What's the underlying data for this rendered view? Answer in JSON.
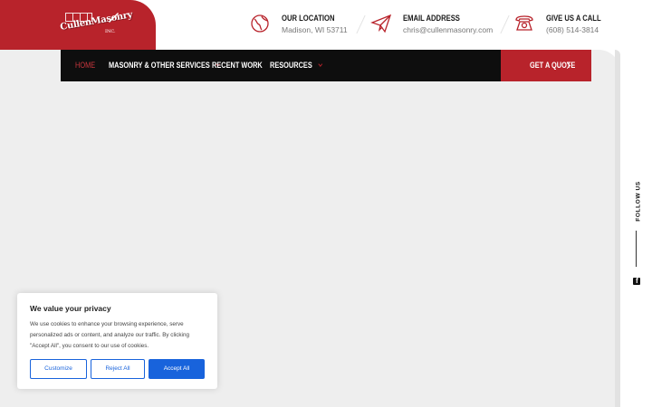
{
  "logo": {
    "name": "CullenMasonry",
    "suffix": "INC."
  },
  "contacts": [
    {
      "title": "OUR LOCATION",
      "value": "Madison, WI 53711",
      "icon": "globe-icon"
    },
    {
      "title": "EMAIL ADDRESS",
      "value": "chris@cullenmasonry.com",
      "icon": "paper-plane-icon"
    },
    {
      "title": "GIVE US A CALL",
      "value": "(608) 514-3814",
      "icon": "phone-icon"
    }
  ],
  "nav": {
    "items": [
      {
        "label": "HOME"
      },
      {
        "label": "MASONRY & OTHER SERVICES"
      },
      {
        "label": "RECENT WORK"
      },
      {
        "label": "RESOURCES"
      }
    ],
    "cta": "GET A QUOTE"
  },
  "social": {
    "label": "FOLLOW US",
    "icon": "facebook-icon"
  },
  "cookie": {
    "title": "We value your privacy",
    "text": "We use cookies to enhance your browsing experience, serve personalized ads or content, and analyze our traffic. By clicking \"Accept All\", you consent to our use of cookies.",
    "customize": "Customize",
    "reject": "Reject All",
    "accept": "Accept All"
  },
  "colors": {
    "brand_red": "#b8232b",
    "nav_bg": "#0e0e0e",
    "cookie_blue": "#1863dc"
  }
}
